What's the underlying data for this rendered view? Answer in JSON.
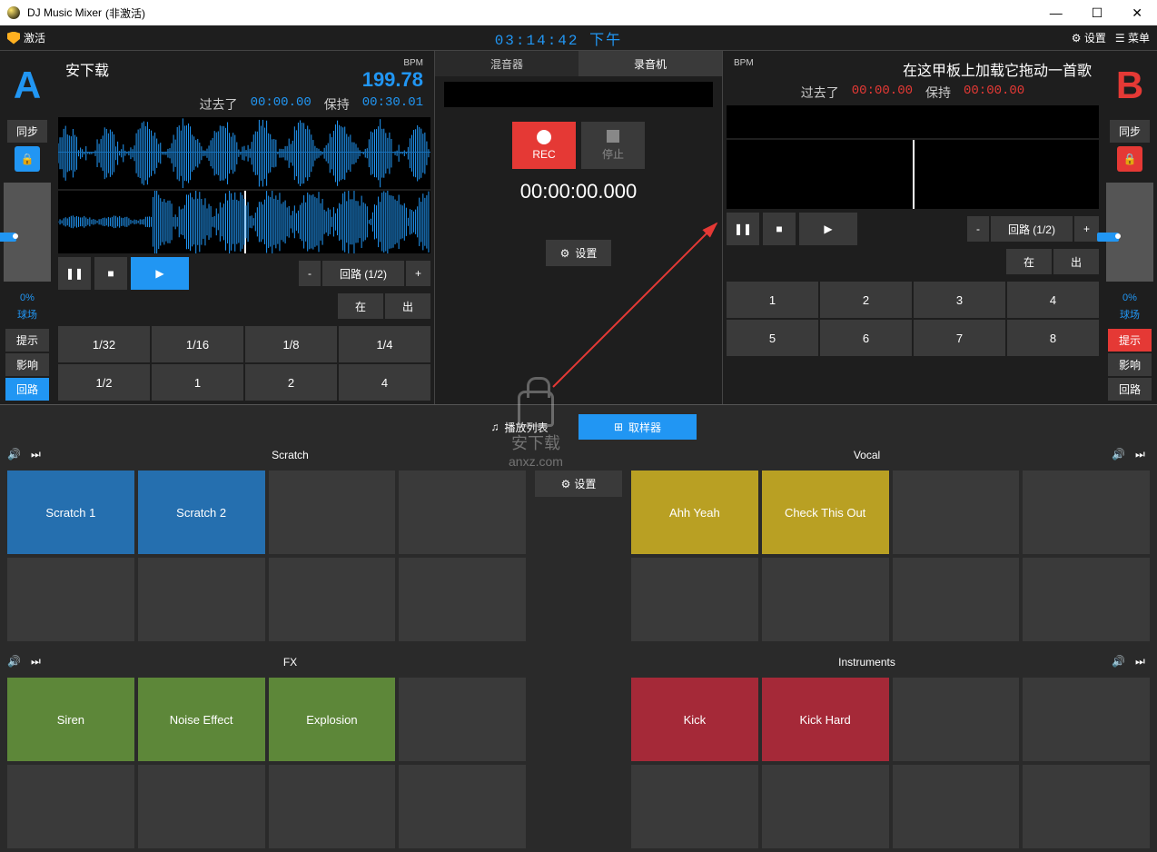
{
  "titlebar": {
    "app": "DJ Music Mixer",
    "status": "(非激活)"
  },
  "topbar": {
    "activate": "激活",
    "clock": "03:14:42 下午",
    "settings": "设置",
    "menu": "菜单"
  },
  "deckA": {
    "letter": "A",
    "sync": "同步",
    "pct": "0%",
    "pitch": "球场",
    "title": "安下载",
    "bpm_label": "BPM",
    "bpm": "199.78",
    "elapsed_lbl": "过去了",
    "elapsed": "00:00.00",
    "remain_lbl": "保持",
    "remain": "00:30.01",
    "loop_label": "回路 (1/2)",
    "in": "在",
    "out": "出",
    "minus": "-",
    "plus": "+",
    "grid": [
      "1/32",
      "1/16",
      "1/8",
      "1/4",
      "1/2",
      "1",
      "2",
      "4"
    ],
    "side": [
      "提示",
      "影响",
      "回路"
    ]
  },
  "deckB": {
    "letter": "B",
    "sync": "同步",
    "pct": "0%",
    "pitch": "球场",
    "title": "在这甲板上加载它拖动一首歌",
    "bpm_label": "BPM",
    "bpm": "",
    "elapsed_lbl": "过去了",
    "elapsed": "00:00.00",
    "remain_lbl": "保持",
    "remain": "00:00.00",
    "loop_label": "回路 (1/2)",
    "in": "在",
    "out": "出",
    "minus": "-",
    "plus": "+",
    "grid": [
      "1",
      "2",
      "3",
      "4",
      "5",
      "6",
      "7",
      "8"
    ],
    "side": [
      "提示",
      "影响",
      "回路"
    ]
  },
  "center": {
    "tab1": "混音器",
    "tab2": "录音机",
    "rec": "REC",
    "stop": "停止",
    "time": "00:00:00.000",
    "settings": "设置"
  },
  "midtabs": {
    "playlist": "播放列表",
    "sampler": "取样器"
  },
  "sampler": {
    "settings": "设置",
    "sections": [
      {
        "title": "Scratch",
        "pads": [
          "Scratch 1",
          "Scratch 2",
          "",
          "",
          "",
          "",
          "",
          ""
        ],
        "color": "blue"
      },
      {
        "title": "Vocal",
        "pads": [
          "Ahh Yeah",
          "Check This Out",
          "",
          "",
          "",
          "",
          "",
          ""
        ],
        "color": "yellow"
      },
      {
        "title": "FX",
        "pads": [
          "Siren",
          "Noise Effect",
          "Explosion",
          "",
          "",
          "",
          "",
          ""
        ],
        "color": "green"
      },
      {
        "title": "Instruments",
        "pads": [
          "Kick",
          "Kick Hard",
          "",
          "",
          "",
          "",
          "",
          ""
        ],
        "color": "red"
      }
    ]
  },
  "watermark": "安下载\nanxz.com"
}
